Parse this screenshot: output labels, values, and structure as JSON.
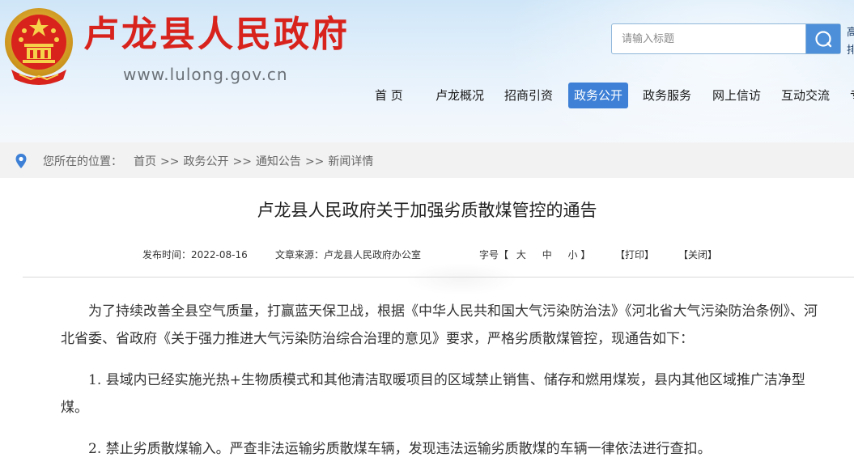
{
  "header": {
    "site_title": "卢龙县人民政府",
    "site_url": "www.lulong.gov.cn",
    "search_placeholder": "请输入标题",
    "side_links": [
      "高",
      "排"
    ]
  },
  "nav": {
    "items": [
      {
        "label": "首  页"
      },
      {
        "label": "卢龙概况"
      },
      {
        "label": "招商引资"
      },
      {
        "label": "政务公开",
        "active": true
      },
      {
        "label": "政务服务"
      },
      {
        "label": "网上信访"
      },
      {
        "label": "互动交流"
      },
      {
        "label": "专"
      }
    ]
  },
  "breadcrumb": {
    "label": "您所在的位置：",
    "items": [
      "首页",
      "政务公开",
      "通知公告",
      "新闻详情"
    ],
    "separator": ">>"
  },
  "article": {
    "title": "卢龙县人民政府关于加强劣质散煤管控的通告",
    "publish_label": "发布时间：",
    "publish_date": "2022-08-16",
    "source_label": "文章来源：",
    "source": "卢龙县人民政府办公室",
    "font_size_label": "字号【",
    "font_large": "大",
    "font_medium": "中",
    "font_small": "小",
    "font_size_end": "】",
    "print": "【打印】",
    "close": "【关闭】",
    "paragraphs": [
      "为了持续改善全县空气质量，打赢蓝天保卫战，根据《中华人民共和国大气污染防治法》《河北省大气污染防治条例》、河北省委、省政府《关于强力推进大气污染防治综合治理的意见》要求，严格劣质散煤管控，现通告如下：",
      "1. 县域内已经实施光热+生物质模式和其他清洁取暖项目的区域禁止销售、储存和燃用煤炭，县内其他区域推广洁净型煤。",
      "2. 禁止劣质散煤输入。严查非法运输劣质散煤车辆，发现违法运输劣质散煤的车辆一律依法进行查扣。"
    ]
  },
  "colors": {
    "title_red": "#d8231d",
    "nav_active": "#3d80d6",
    "search_button": "#4d8fd9"
  }
}
